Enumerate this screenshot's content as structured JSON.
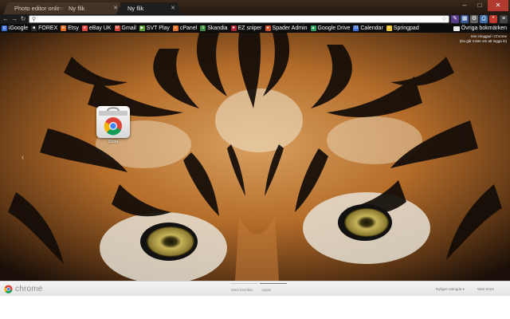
{
  "tabs": [
    {
      "label": "Photo editor online",
      "active": false
    },
    {
      "label": "Ny flik",
      "active": false
    },
    {
      "label": "Ny flik",
      "active": true
    }
  ],
  "window_controls": {
    "minimize": "–",
    "maximize": "□",
    "close": "✕"
  },
  "toolbar": {
    "back": "←",
    "forward": "→",
    "reload": "↻",
    "omnibox_value": "",
    "omnibox_placeholder": ""
  },
  "bookmarks": [
    {
      "label": "iGoogle",
      "icon": "google-icon",
      "color": "#3b6fd8",
      "glyph": "g"
    },
    {
      "label": "FOREX",
      "icon": "forex-icon",
      "color": "#2a2a2a",
      "glyph": "■"
    },
    {
      "label": "Etsy",
      "icon": "etsy-icon",
      "color": "#e56b1f",
      "glyph": "E"
    },
    {
      "label": "eBay UK",
      "icon": "ebay-icon",
      "color": "#e0443a",
      "glyph": "e"
    },
    {
      "label": "Gmail",
      "icon": "gmail-icon",
      "color": "#d23f31",
      "glyph": "M"
    },
    {
      "label": "SVT Play",
      "icon": "svt-icon",
      "color": "#5a9e2f",
      "glyph": "▶"
    },
    {
      "label": "cPanel",
      "icon": "cpanel-icon",
      "color": "#e8742c",
      "glyph": "c"
    },
    {
      "label": "Skandia",
      "icon": "skandia-icon",
      "color": "#3c8f3a",
      "glyph": "S"
    },
    {
      "label": "EZ sniper",
      "icon": "flag-icon",
      "color": "#b22234",
      "glyph": "★"
    },
    {
      "label": "Spader Admin",
      "icon": "spader-icon",
      "color": "#d0502a",
      "glyph": "♠"
    },
    {
      "label": "Google Drive",
      "icon": "drive-icon",
      "color": "#2f9e5a",
      "glyph": "▲"
    },
    {
      "label": "Calendar",
      "icon": "calendar-icon",
      "color": "#3b6fd8",
      "glyph": "31"
    },
    {
      "label": "Springpad",
      "icon": "springpad-icon",
      "color": "#f2c430",
      "glyph": "s"
    }
  ],
  "other_bookmarks": "Övriga bokmärken",
  "signin": {
    "line1": "Inte inloggad i Chrome",
    "line2": "(Du går miste om att logga in)"
  },
  "apps": [
    {
      "label": "Store",
      "icon": "chrome-web-store-icon"
    }
  ],
  "footer": {
    "brand": "chrome",
    "tabs": [
      {
        "label": "Mest besökta",
        "active": false
      },
      {
        "label": "Appar",
        "active": true
      }
    ],
    "recently_closed": "Nyligen stängda ▾",
    "web_store": "Web Store"
  },
  "colors": {
    "titlebar": "#2d2016",
    "toolbar": "#1c1c1c",
    "bookmarks_bar": "#0c0c0c",
    "footer": "#ececec"
  }
}
